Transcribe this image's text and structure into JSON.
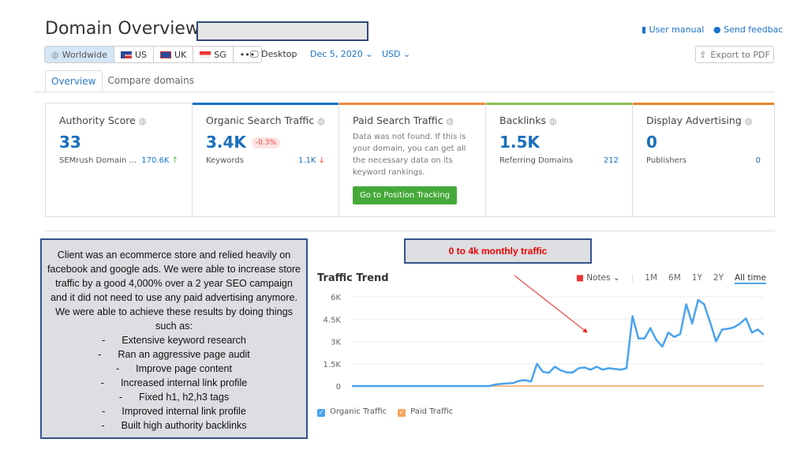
{
  "header": {
    "title": "Domain Overview:",
    "user_manual": "User manual",
    "send_feedback": "Send feedbac",
    "export": "Export to PDF"
  },
  "regions": [
    {
      "label": "Worldwide",
      "icon": "globe-icon"
    },
    {
      "label": "US",
      "icon": "us-flag-icon"
    },
    {
      "label": "UK",
      "icon": "uk-flag-icon"
    },
    {
      "label": "SG",
      "icon": "sg-flag-icon"
    },
    {
      "label": "•••",
      "icon": "more-icon"
    }
  ],
  "filters": {
    "device": "Desktop",
    "date": "Dec 5, 2020",
    "currency": "USD"
  },
  "tabs": [
    {
      "label": "Overview",
      "active": true
    },
    {
      "label": "Compare domains"
    }
  ],
  "cards": {
    "authority": {
      "title": "Authority Score",
      "value": "33",
      "sub_label": "SEMrush Domain ...",
      "sub_value": "170.6K",
      "trend": "↑"
    },
    "organic": {
      "title": "Organic Search Traffic",
      "value": "3.4K",
      "badge": "-0.3%",
      "sub_label": "Keywords",
      "sub_value": "1.1K",
      "trend": "↓",
      "accent": "#1a73c8"
    },
    "paid": {
      "title": "Paid Search Traffic",
      "message": "Data was not found. If this is your domain, you can get all the necessary data on its keyword rankings.",
      "button": "Go to Position Tracking",
      "accent": "#f2883a"
    },
    "backlinks": {
      "title": "Backlinks",
      "value": "1.5K",
      "sub_label": "Referring Domains",
      "sub_value": "212",
      "accent": "#8cc152"
    },
    "display": {
      "title": "Display Advertising",
      "value": "0",
      "sub_label": "Publishers",
      "sub_value": "0",
      "accent": "#e8862a"
    }
  },
  "note": {
    "intro": "Client was an ecommerce store and relied heavily on facebook and google ads. We were able to increase store traffic by a good 4,000% over a 2 year SEO campaign and it did not need to use any paid advertising anymore. We were able to achieve these results by doing things such as:",
    "items": [
      "Extensive keyword research",
      "Ran an aggressive page audit",
      "Improve page content",
      "Increased internal link profile",
      "Fixed h1, h2,h3 tags",
      "Improved internal link profile",
      "Built high authority backlinks"
    ]
  },
  "callout": "0 to 4k monthly traffic",
  "trend": {
    "title": "Traffic Trend",
    "notes": "Notes",
    "periods": [
      "1M",
      "6M",
      "1Y",
      "2Y",
      "All time"
    ],
    "selected_period": "All time"
  },
  "chart_data": {
    "type": "line",
    "title": "Traffic Trend",
    "yticks": [
      "6K",
      "4.5K",
      "3K",
      "1.5K",
      "0"
    ],
    "ylim": [
      0,
      6000
    ],
    "grid": true,
    "legend": "bottom-left",
    "series": [
      {
        "name": "Organic Traffic",
        "color": "#4aa3ee",
        "values": [
          0,
          0,
          0,
          0,
          0,
          0,
          0,
          0,
          0,
          0,
          0,
          0,
          0,
          0,
          0,
          0,
          0,
          0,
          0,
          0,
          0,
          0,
          0,
          0,
          100,
          150,
          180,
          200,
          350,
          400,
          300,
          1500,
          950,
          900,
          1300,
          1050,
          920,
          920,
          1200,
          1250,
          1100,
          1300,
          1100,
          1200,
          1150,
          1100,
          1200,
          4700,
          3200,
          3200,
          3900,
          3100,
          2650,
          3600,
          3300,
          3500,
          5500,
          4200,
          5800,
          5500,
          4300,
          3000,
          3800,
          3850,
          3950,
          4200,
          4550,
          3600,
          3800,
          3450
        ]
      },
      {
        "name": "Paid Traffic",
        "color": "#f4a460",
        "values": [
          0,
          0,
          0,
          0,
          0,
          0,
          0,
          0,
          0,
          0,
          0,
          0,
          0,
          0,
          0,
          0,
          0,
          0,
          0,
          0,
          0,
          0,
          0,
          0,
          0,
          0,
          0,
          0,
          0,
          0,
          0,
          0,
          0,
          0,
          0,
          0,
          0,
          0,
          0,
          0,
          0,
          0,
          0,
          0,
          0,
          0,
          0,
          0,
          0,
          0,
          0,
          0,
          0,
          0,
          0,
          0,
          0,
          0,
          0,
          0,
          0,
          0,
          0,
          0,
          0,
          0,
          0,
          0,
          0,
          0
        ]
      }
    ]
  }
}
